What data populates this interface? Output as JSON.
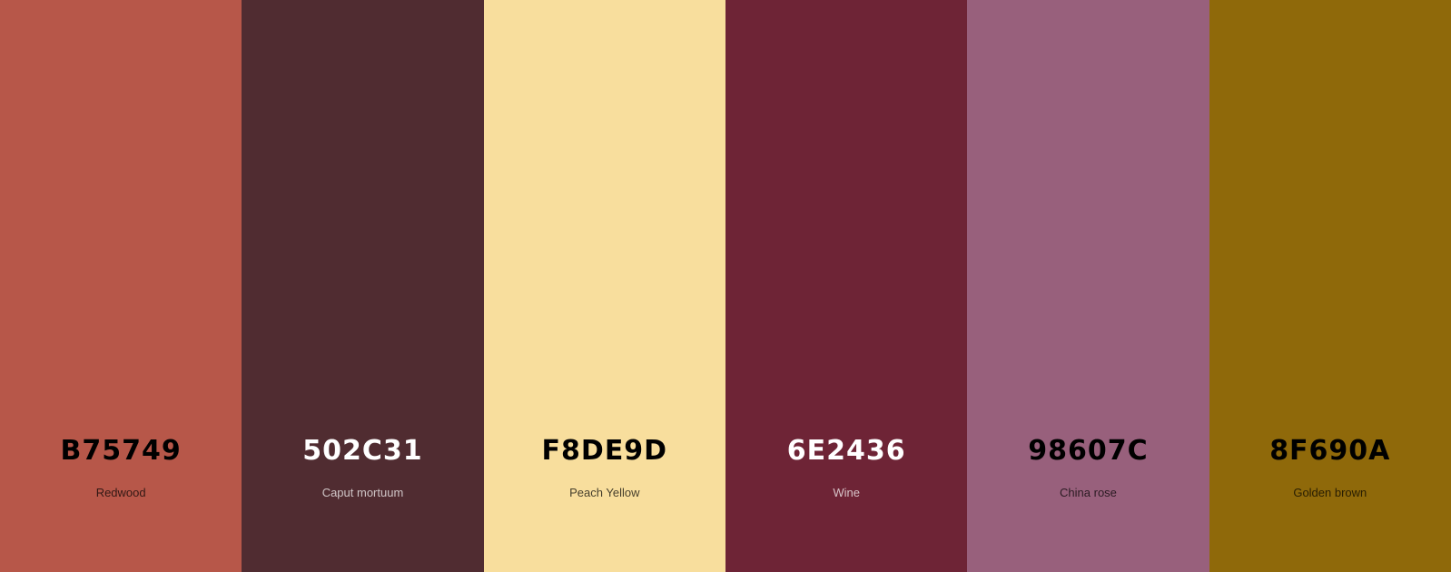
{
  "swatches": [
    {
      "hex": "B75749",
      "name": "Redwood",
      "color": "#B75749",
      "text_color": "#000000"
    },
    {
      "hex": "502C31",
      "name": "Caput mortuum",
      "color": "#502C31",
      "text_color": "#FFFFFF"
    },
    {
      "hex": "F8DE9D",
      "name": "Peach Yellow",
      "color": "#F8DE9D",
      "text_color": "#000000"
    },
    {
      "hex": "6E2436",
      "name": "Wine",
      "color": "#6E2436",
      "text_color": "#FFFFFF"
    },
    {
      "hex": "98607C",
      "name": "China rose",
      "color": "#98607C",
      "text_color": "#000000"
    },
    {
      "hex": "8F690A",
      "name": "Golden brown",
      "color": "#8F690A",
      "text_color": "#000000"
    }
  ]
}
